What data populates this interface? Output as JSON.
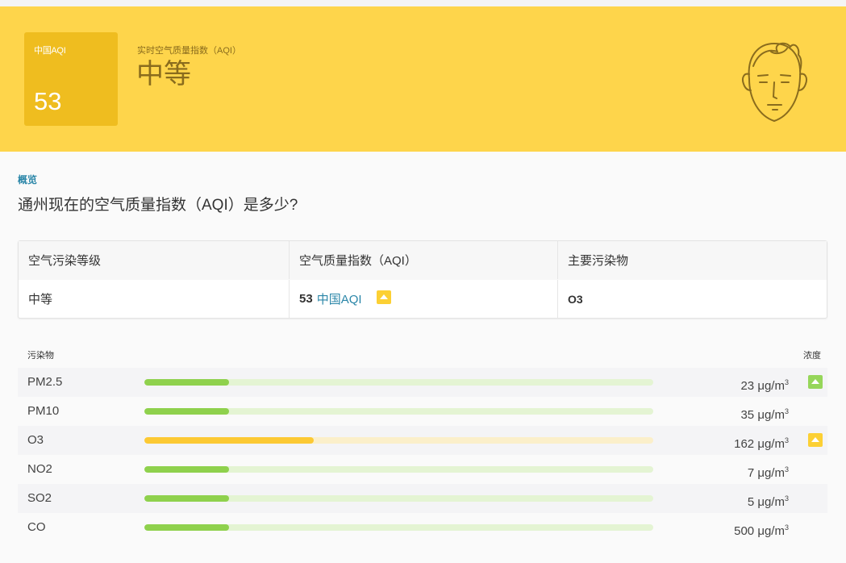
{
  "banner": {
    "aqi_label": "中国AQI",
    "aqi_value": "53",
    "subtitle": "实时空气质量指数（AQI）",
    "level": "中等",
    "color": "#fed54b",
    "face_icon": "neutral-face-icon"
  },
  "overview": {
    "link": "概览",
    "question": "通州现在的空气质量指数（AQI）是多少?"
  },
  "summary": {
    "headers": [
      "空气污染等级",
      "空气质量指数（AQI）",
      "主要污染物"
    ],
    "level": "中等",
    "aqi_value": "53",
    "aqi_unit": "中国AQI",
    "main_pollutant": "O3"
  },
  "pollutants": {
    "header_left": "污染物",
    "header_right": "浓度",
    "unit": "μg/m",
    "unit_sup": "3",
    "rows": [
      {
        "name": "PM2.5",
        "value": "23",
        "level_fraction": 0.166,
        "color": "green",
        "badge": "green"
      },
      {
        "name": "PM10",
        "value": "35",
        "level_fraction": 0.166,
        "color": "green",
        "badge": ""
      },
      {
        "name": "O3",
        "value": "162",
        "level_fraction": 0.333,
        "color": "yellow",
        "badge": "yellow"
      },
      {
        "name": "NO2",
        "value": "7",
        "level_fraction": 0.166,
        "color": "green",
        "badge": ""
      },
      {
        "name": "SO2",
        "value": "5",
        "level_fraction": 0.166,
        "color": "green",
        "badge": ""
      },
      {
        "name": "CO",
        "value": "500",
        "level_fraction": 0.166,
        "color": "green",
        "badge": ""
      }
    ]
  }
}
